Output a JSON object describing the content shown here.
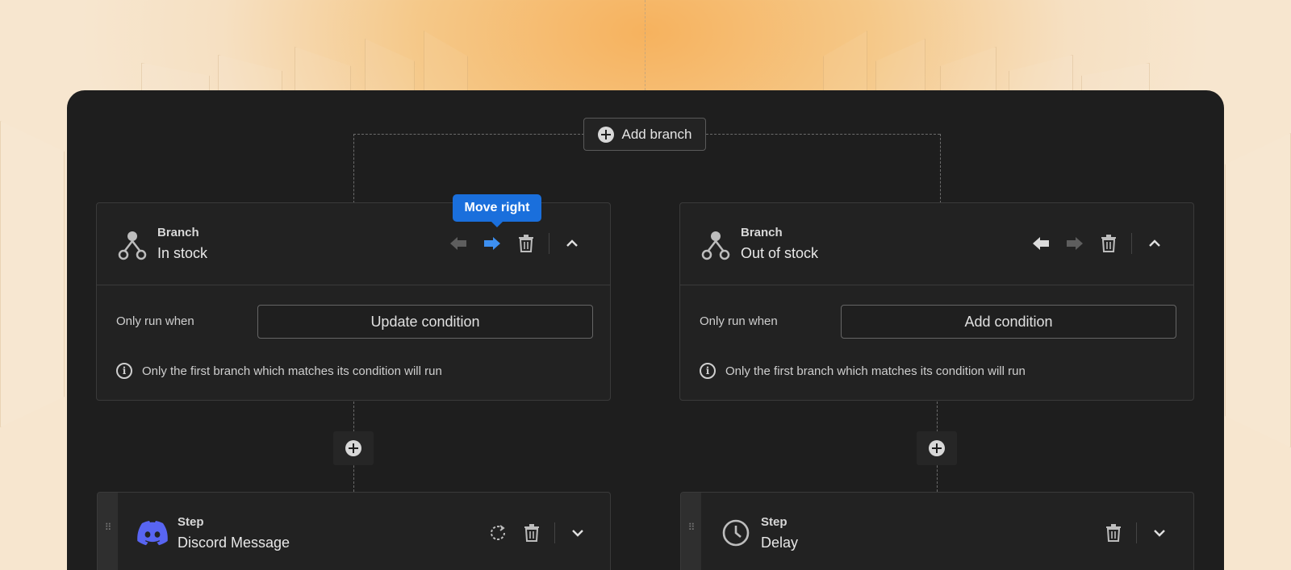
{
  "add_branch": {
    "label": "Add branch"
  },
  "tooltip": {
    "label": "Move right"
  },
  "branches": [
    {
      "kind": "Branch",
      "name": "In stock",
      "only_run_label": "Only run when",
      "condition_button": "Update condition",
      "info_text": "Only the first branch which matches its condition will run",
      "info_icon_glyph": "i"
    },
    {
      "kind": "Branch",
      "name": "Out of stock",
      "only_run_label": "Only run when",
      "condition_button": "Add condition",
      "info_text": "Only the first branch which matches its condition will run",
      "info_icon_glyph": "i"
    }
  ],
  "steps": [
    {
      "kind": "Step",
      "name": "Discord Message",
      "icon": "discord-icon"
    },
    {
      "kind": "Step",
      "name": "Delay",
      "icon": "clock-icon"
    }
  ],
  "colors": {
    "accent": "#1a6fdc",
    "arrow_active": "#3d8ff0",
    "discord": "#5865f2",
    "canvas": "#1e1e1e",
    "card": "#222222"
  },
  "icons": {
    "drag_glyph": "⠿"
  }
}
